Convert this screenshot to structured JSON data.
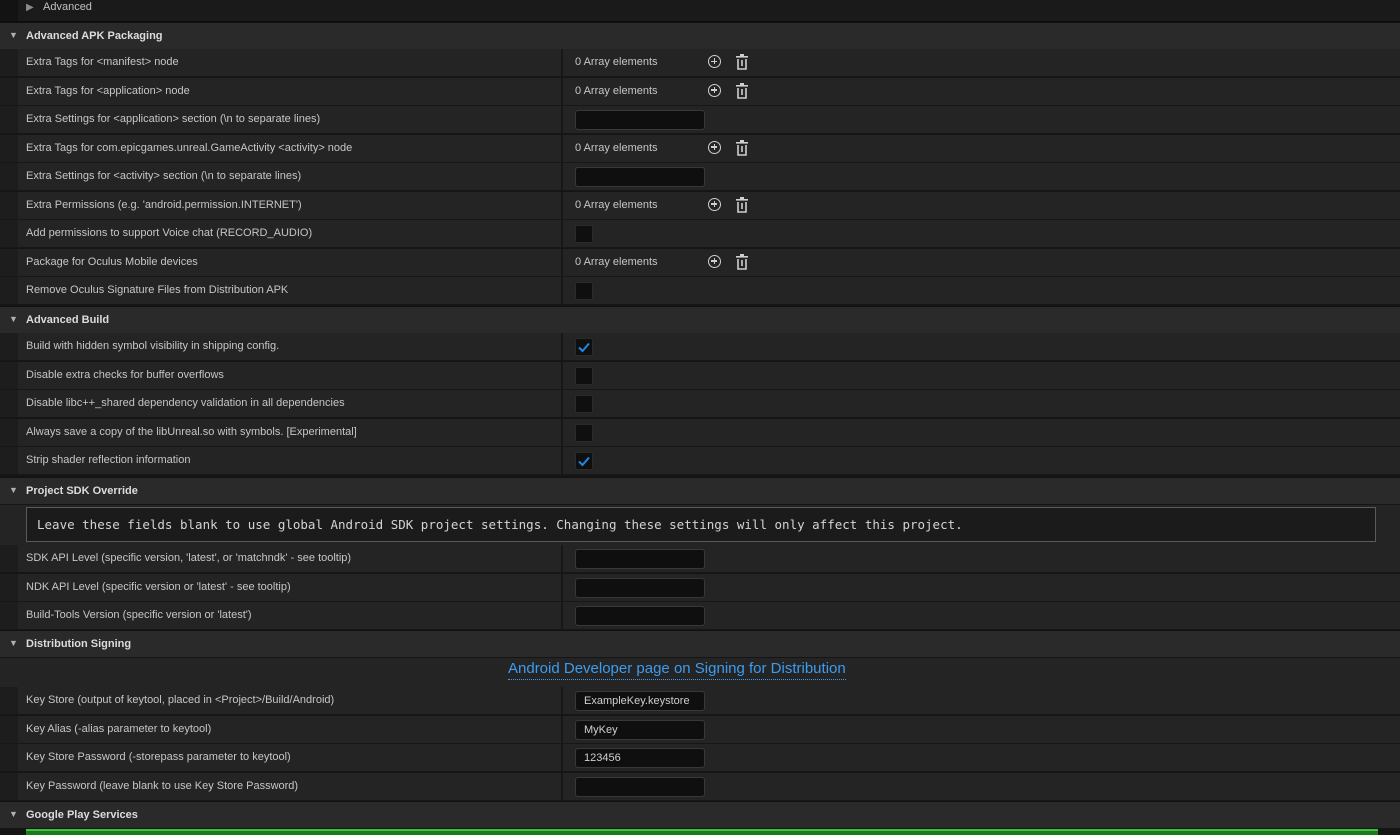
{
  "advanced": {
    "label": "Advanced"
  },
  "sections": {
    "apk": {
      "title": "Advanced APK Packaging"
    },
    "build": {
      "title": "Advanced Build"
    },
    "sdk": {
      "title": "Project SDK Override",
      "note": "Leave these fields blank to use global Android SDK project settings. Changing these settings will only affect this project."
    },
    "signing": {
      "title": "Distribution Signing",
      "link": "Android Developer page on Signing for Distribution"
    },
    "gps": {
      "title": "Google Play Services"
    }
  },
  "apk_rows": [
    {
      "label": "Extra Tags for <manifest> node",
      "type": "array",
      "value": "0 Array elements"
    },
    {
      "label": "Extra Tags for <application> node",
      "type": "array",
      "value": "0 Array elements"
    },
    {
      "label": "Extra Settings for <application> section (\\n to separate lines)",
      "type": "text",
      "value": ""
    },
    {
      "label": "Extra Tags for com.epicgames.unreal.GameActivity <activity> node",
      "type": "array",
      "value": "0 Array elements"
    },
    {
      "label": "Extra Settings for <activity> section (\\n to separate lines)",
      "type": "text",
      "value": ""
    },
    {
      "label": "Extra Permissions (e.g. 'android.permission.INTERNET')",
      "type": "array",
      "value": "0 Array elements"
    },
    {
      "label": "Add permissions to support Voice chat (RECORD_AUDIO)",
      "type": "check",
      "checked": false
    },
    {
      "label": "Package for Oculus Mobile devices",
      "type": "array",
      "value": "0 Array elements"
    },
    {
      "label": "Remove Oculus Signature Files from Distribution APK",
      "type": "check",
      "checked": false
    }
  ],
  "build_rows": [
    {
      "label": "Build with hidden symbol visibility in shipping config.",
      "type": "check",
      "checked": true
    },
    {
      "label": "Disable extra checks for buffer overflows",
      "type": "check",
      "checked": false
    },
    {
      "label": "Disable libc++_shared dependency validation in all dependencies",
      "type": "check",
      "checked": false
    },
    {
      "label": "Always save a copy of the libUnreal.so with symbols. [Experimental]",
      "type": "check",
      "checked": false
    },
    {
      "label": "Strip shader reflection information",
      "type": "check",
      "checked": true
    }
  ],
  "sdk_rows": [
    {
      "label": "SDK API Level (specific version, 'latest', or 'matchndk' - see tooltip)",
      "type": "text",
      "value": ""
    },
    {
      "label": "NDK API Level (specific version or 'latest' - see tooltip)",
      "type": "text",
      "value": ""
    },
    {
      "label": "Build-Tools Version (specific version or 'latest')",
      "type": "text",
      "value": ""
    }
  ],
  "signing_rows": [
    {
      "label": "Key Store (output of keytool, placed in <Project>/Build/Android)",
      "type": "text",
      "value": "ExampleKey.keystore"
    },
    {
      "label": "Key Alias (-alias parameter to keytool)",
      "type": "text",
      "value": "MyKey"
    },
    {
      "label": "Key Store Password (-storepass parameter to keytool)",
      "type": "text",
      "value": "123456"
    },
    {
      "label": "Key Password (leave blank to use Key Store Password)",
      "type": "text",
      "value": ""
    }
  ],
  "colors": {
    "accent_check": "#1e88e5",
    "link": "#3d9cf0",
    "play_bar": "#3ec03e"
  },
  "icons": {
    "add": "plus-circle-icon",
    "delete": "trash-icon",
    "expanded": "triangle-down-icon",
    "collapsed": "triangle-right-icon"
  }
}
